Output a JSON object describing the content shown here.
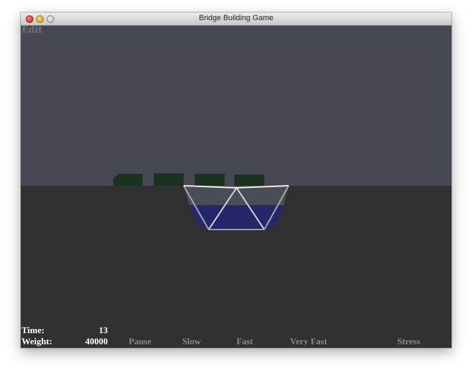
{
  "window": {
    "title": "Bridge Building Game"
  },
  "menu": {
    "edit_label": "Edit"
  },
  "hud": {
    "time_label": "Time:",
    "time_value": "13",
    "weight_label": "Weight:",
    "weight_value": "40000"
  },
  "controls": {
    "pause": "Pause",
    "slow": "Slow",
    "fast": "Fast",
    "very_fast": "Very Fast",
    "stress": "Stress"
  },
  "colors": {
    "sky": "#454852",
    "ground": "#303030",
    "water": "#26276a",
    "train": "#1c3220",
    "beam": "#e6e6e6",
    "control_text": "#8a8a8a"
  }
}
